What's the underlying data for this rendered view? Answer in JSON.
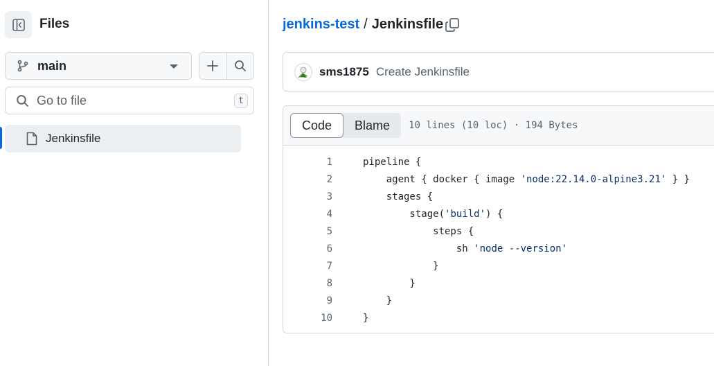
{
  "sidebar": {
    "title": "Files",
    "branch": "main",
    "search_placeholder": "Go to file",
    "shortcut_key": "t",
    "tree": [
      {
        "label": "Jenkinsfile",
        "icon": "file-icon",
        "active": true
      }
    ]
  },
  "breadcrumb": {
    "repo": "jenkins-test",
    "separator": "/",
    "file": "Jenkinsfile"
  },
  "commit": {
    "user": "sms1875",
    "message": "Create Jenkinsfile"
  },
  "code_view": {
    "tabs": [
      "Code",
      "Blame"
    ],
    "active_tab": "Code",
    "meta": "10 lines (10 loc) · 194 Bytes",
    "lines": [
      {
        "n": "1",
        "code": "pipeline {"
      },
      {
        "n": "2",
        "code": "    agent { docker { image 'node:22.14.0-alpine3.21' } }"
      },
      {
        "n": "3",
        "code": "    stages {"
      },
      {
        "n": "4",
        "code": "        stage('build') {"
      },
      {
        "n": "5",
        "code": "            steps {"
      },
      {
        "n": "6",
        "code": "                sh 'node --version'"
      },
      {
        "n": "7",
        "code": "            }"
      },
      {
        "n": "8",
        "code": "        }"
      },
      {
        "n": "9",
        "code": "    }"
      },
      {
        "n": "10",
        "code": "}"
      }
    ]
  },
  "colors": {
    "accent": "#0969da",
    "string": "#0a3069",
    "border": "#d1d9e0",
    "muted_text": "#59636e"
  }
}
